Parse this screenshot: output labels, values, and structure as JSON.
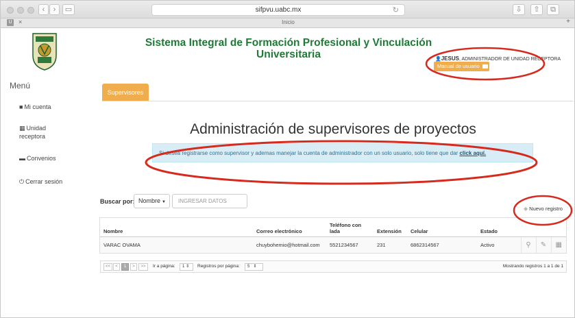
{
  "browser": {
    "url": "sifpvu.uabc.mx",
    "tab_title": "Inicio",
    "tab_left_badge": "U",
    "tab_close": "×",
    "new_tab": "+"
  },
  "header": {
    "title": "Sistema Integral de Formación Profesional y Vinculación Universitaria",
    "user_name": "JESUS",
    "user_role": ", ADMINISTRADOR DE UNIDAD RECEPTORA",
    "manual_label": "Manual de usuario"
  },
  "sidebar": {
    "title": "Menú",
    "items": [
      {
        "label": "Mi cuenta",
        "icon": "user-icon"
      },
      {
        "label": "Unidad receptora",
        "icon": "grid-icon"
      },
      {
        "label": "Convenios",
        "icon": "folder-icon"
      },
      {
        "label": "Cerrar sesión",
        "icon": "power-icon"
      }
    ]
  },
  "tabs": [
    {
      "label": "Supervisores",
      "active": true
    }
  ],
  "main": {
    "heading": "Administración de supervisores de proyectos",
    "alert_text": "Si desea registrarse como supervisor y ademas manejar la cuenta de administrador con un solo usuario, solo tiene que dar ",
    "alert_link": "click aquí."
  },
  "search": {
    "label": "Buscar por:",
    "field_selected": "Nombre",
    "placeholder": "INGRESAR DATOS"
  },
  "new_record_label": "Nuevo registro",
  "table": {
    "columns": [
      "Nombre",
      "Correo electrónico",
      "Teléfono con lada",
      "Extensión",
      "Celular",
      "Estado"
    ],
    "rows": [
      {
        "nombre": "VARAC OVAMA",
        "correo": "chuybohemio@hotmail.com",
        "telefono": "5521234567",
        "extension": "231",
        "celular": "6862314567",
        "estado": "Activo"
      }
    ]
  },
  "pagination": {
    "first": "<<",
    "prev": "<",
    "current_page": "1",
    "next": ">",
    "last": ">>",
    "go_to_label": "Ir a página:",
    "go_to_value": "1",
    "per_page_label": "Registros por página:",
    "per_page_value": "5",
    "summary": "Mostrando registros 1 a 1 de 1"
  },
  "colors": {
    "title_green": "#1f7a36",
    "accent_orange": "#f0ad4e",
    "alert_bg": "#d9edf7",
    "annotation_red": "#d62a1e"
  }
}
